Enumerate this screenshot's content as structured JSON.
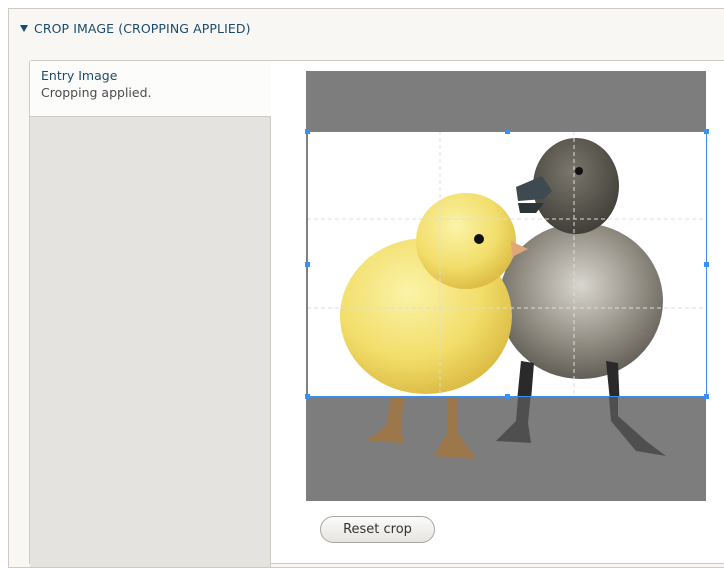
{
  "details": {
    "summary_label": "CROP IMAGE (CROPPING APPLIED)"
  },
  "vertical_tab": {
    "title": "Entry Image",
    "summary": "Cropping applied."
  },
  "crop_widget": {
    "image_subject": "chick-and-duckling",
    "reset_label": "Reset crop"
  },
  "colors": {
    "accent": "#3b8ff0",
    "link": "#1a4b6e",
    "overlay": "#8a8a8a"
  }
}
